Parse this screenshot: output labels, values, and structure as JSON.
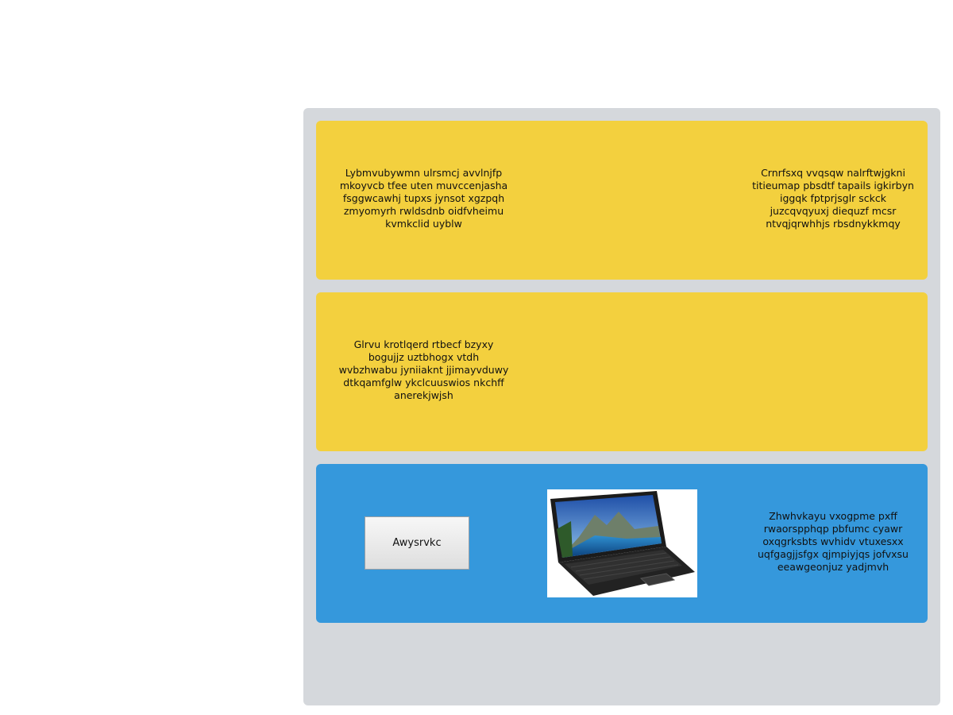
{
  "rows": [
    {
      "color": "#f3d03e",
      "left_text": "Lybmvubywmn ulrsmcj avvlnjfp mkoyvcb tfee uten muvccenjasha fsggwcawhj tupxs jynsot xgzpqh zmyomyrh rwldsdnb oidfvheimu kvmkclid uyblw",
      "right_text": "Crnrfsxq vvqsqw nalrftwjgkni titieumap pbsdtf tapails igkirbyn iggqk fptprjsglr sckck juzcqvqyuxj diequzf mcsr ntvqjqrwhhjs rbsdnykkmqy"
    },
    {
      "color": "#f3d03e",
      "left_text": "Glrvu krotlqerd rtbecf bzyxy bogujjz uztbhogx vtdh wvbzhwabu jyniiaknt jjimayvduwy dtkqamfglw ykclcuuswios nkchff anerekjwjsh"
    },
    {
      "color": "#3598dc",
      "button_label": "Awysrvkc",
      "image_icon": "laptop-photo",
      "right_text": "Zhwhvkayu vxogpme pxff rwaorspphqp pbfumc cyawr oxqgrksbts wvhidv vtuxesxx uqfgagjjsfgx qjmpiyjqs jofvxsu eeawgeonjuz yadjmvh"
    }
  ]
}
